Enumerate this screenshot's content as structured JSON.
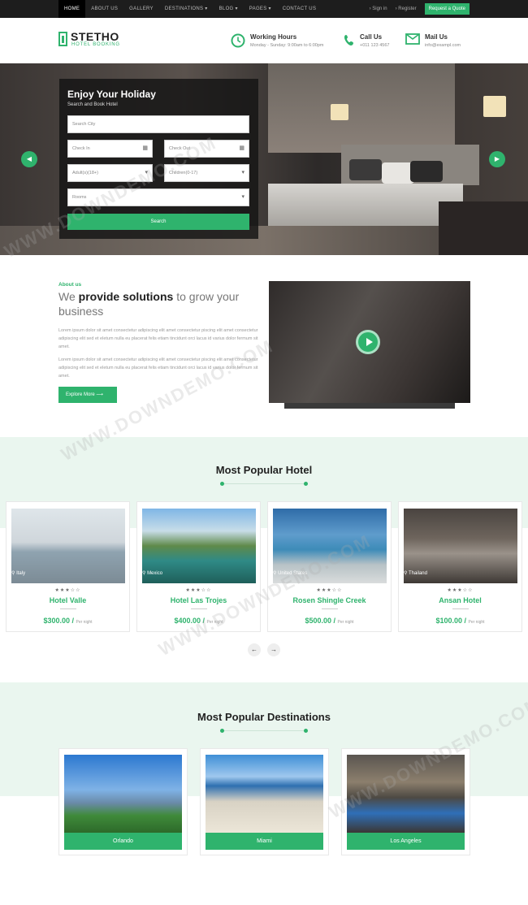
{
  "nav": {
    "items": [
      "HOME",
      "ABOUT US",
      "GALLERY",
      "DESTINATIONS ▾",
      "BLOG ▾",
      "PAGES ▾",
      "CONTACT US"
    ],
    "signin": "› Sign in",
    "register": "› Register",
    "quote": "Request a Quote"
  },
  "logo": {
    "name": "STETHO",
    "sub": "HOTEL BOOKING"
  },
  "header": {
    "hours_title": "Working Hours",
    "hours_text": "Monday - Sunday: 9:00am to 6:00pm",
    "call_title": "Call Us",
    "call_text": "+011 123 4567",
    "mail_title": "Mail Us",
    "mail_text": "info@exampl.com"
  },
  "booking": {
    "title": "Enjoy Your Holiday",
    "subtitle": "Search and Book Hotel",
    "city": "Search City",
    "checkin": "Check In",
    "checkout": "Check Out",
    "adults": "Adult(s)(18+)",
    "children": "Children(0-17)",
    "rooms": "Rooms",
    "search": "Search"
  },
  "about": {
    "label": "About us",
    "title_a": "We ",
    "title_b": "provide solutions",
    "title_c": " to grow your business",
    "p1": "Lorem ipsum dolor sit amet consectetur adipiscing elit amet consectetur piscing elit amet consectetur adipiscing elit sed et eletum nulla eu placerat felis etiam tincidunt orci lacus id varius dolor fermum sit amet.",
    "p2": "Lorem ipsum dolor sit amet consectetur adipiscing elit amet consectetur piscing elit amet consectetur adipiscing elit sed et eletum nulla eu placerat felis etiam tincidunt orci lacus id varius dolor fermum sit amet.",
    "button": "Explore More ⟶"
  },
  "hotels": {
    "title": "Most Popular Hotel",
    "items": [
      {
        "name": "Hotel Valle",
        "location": "Italy",
        "price": "$300.00 /",
        "per": "Per night",
        "stars": "★★★☆☆"
      },
      {
        "name": "Hotel Las Trojes",
        "location": "Mexico",
        "price": "$400.00 /",
        "per": "Per night",
        "stars": "★★★☆☆"
      },
      {
        "name": "Rosen Shingle Creek",
        "location": "United States",
        "price": "$500.00 /",
        "per": "Per night",
        "stars": "★★★☆☆"
      },
      {
        "name": "Ansan Hotel",
        "location": "Thailand",
        "price": "$100.00 /",
        "per": "Per night",
        "stars": "★★★☆☆"
      }
    ],
    "prev": "←",
    "next": "→"
  },
  "destinations": {
    "title": "Most Popular Destinations",
    "items": [
      "Orlando",
      "Miami",
      "Los Angeles"
    ]
  },
  "colors": {
    "accent": "#2fb36d",
    "topbar": "#1d1d1d",
    "section_bg": "#eaf6ef"
  },
  "watermark": "WWW.DOWNDEMO.COM"
}
